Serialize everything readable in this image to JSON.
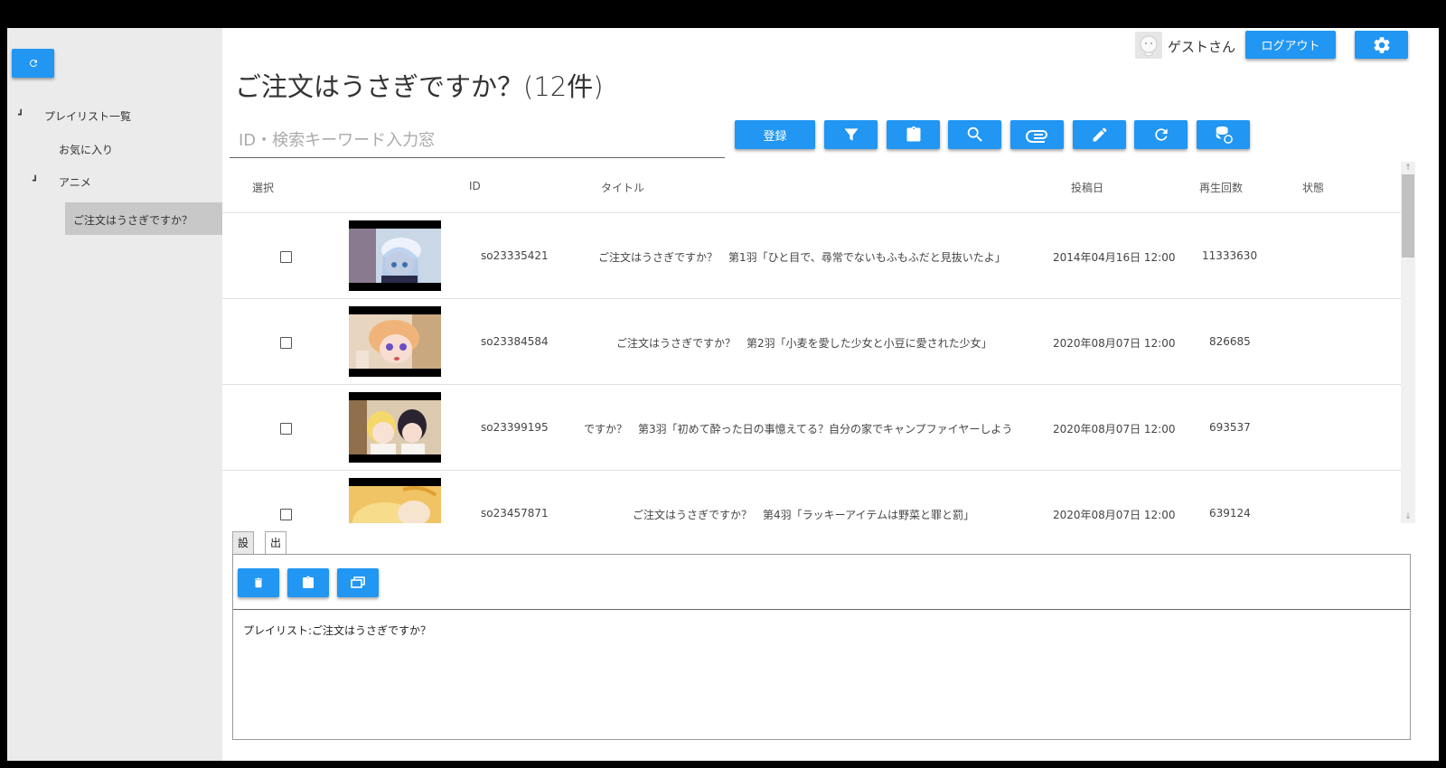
{
  "sidebar": {
    "refresh_icon": "refresh-icon",
    "tree": {
      "root_label": "プレイリスト一覧",
      "favorites_label": "お気に入り",
      "anime_label": "アニメ",
      "selected_label": "ご注文はうさぎですか？"
    }
  },
  "header": {
    "username": "ゲストさん",
    "logout_label": "ログアウト",
    "settings_icon": "gear-icon"
  },
  "main": {
    "title": "ご注文はうさぎですか？(12件)",
    "search_placeholder": "ID・検索キーワード入力窓",
    "register_label": "登録",
    "toolbar_icons": [
      "filter-icon",
      "clipboard-icon",
      "search-icon",
      "paperclip-icon",
      "edit-icon",
      "refresh-icon",
      "database-sync-icon"
    ]
  },
  "table": {
    "columns": {
      "select": "選択",
      "id": "ID",
      "title": "タイトル",
      "posted": "投稿日",
      "views": "再生回数",
      "status": "状態"
    },
    "rows": [
      {
        "id": "so23335421",
        "title": "ご注文はうさぎですか？　第1羽「ひと目で、尋常でないもふもふだと見抜いたよ」",
        "posted": "2014年04月16日 12:00",
        "views": "11333630",
        "status": ""
      },
      {
        "id": "so23384584",
        "title": "ご注文はうさぎですか？　第2羽「小麦を愛した少女と小豆に愛された少女」",
        "posted": "2020年08月07日 12:00",
        "views": "826685",
        "status": ""
      },
      {
        "id": "so23399195",
        "title": "ですか？　第3羽「初めて酔った日の事憶えてる？自分の家でキャンプファイヤーしよう",
        "posted": "2020年08月07日 12:00",
        "views": "693537",
        "status": ""
      },
      {
        "id": "so23457871",
        "title": "ご注文はうさぎですか？　第4羽「ラッキーアイテムは野菜と罪と罰」",
        "posted": "2020年08月07日 12:00",
        "views": "639124",
        "status": ""
      }
    ]
  },
  "bottom": {
    "tabs": [
      "設定",
      "出力"
    ],
    "active_tab": "出力",
    "output_icons": [
      "trash-icon",
      "clipboard-icon",
      "copy-window-icon"
    ],
    "output_text": "プレイリスト:ご注文はうさぎですか？"
  },
  "colors": {
    "accent": "#2196f3",
    "sidebar_bg": "#ebebeb",
    "selected_bg": "#c8c8c8"
  }
}
